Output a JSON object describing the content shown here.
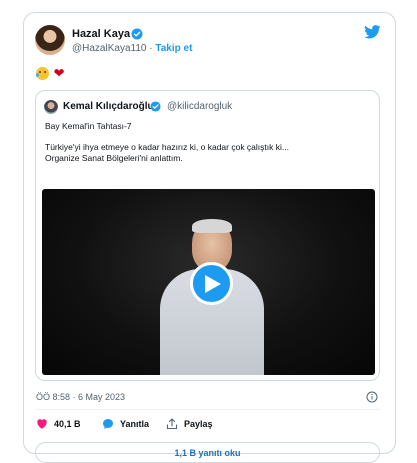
{
  "author": {
    "name": "Hazal Kaya",
    "handle": "@HazalKaya110",
    "separator": "·",
    "follow_label": "Takip et"
  },
  "tweet": {
    "emojis": [
      "face-with-tear-of-joy",
      "red-heart"
    ]
  },
  "quoted": {
    "name": "Kemal Kılıçdaroğlu",
    "handle": "@kilicdarogluk",
    "line1": "Bay Kemal'in Tahtası-7",
    "line2": "Türkiye'yi ihya etmeye o kadar hazırız ki, o kadar çok çalıştık ki...",
    "line3": "Organize Sanat Bölgeleri'ni anlattım."
  },
  "timestamp": "ÖÖ 8:58 · 6 May 2023",
  "actions": {
    "likes": "40,1 B",
    "reply_label": "Yanıtla",
    "share_label": "Paylaş"
  },
  "read_replies": "1,1 B yanıtı oku",
  "colors": {
    "accent": "#1d9bf0",
    "heart": "#f91880",
    "verified": "#1d9bf0"
  },
  "icons": [
    "verified-badge-icon",
    "twitter-bird-icon",
    "play-icon",
    "info-icon",
    "heart-icon",
    "reply-icon",
    "share-icon"
  ]
}
